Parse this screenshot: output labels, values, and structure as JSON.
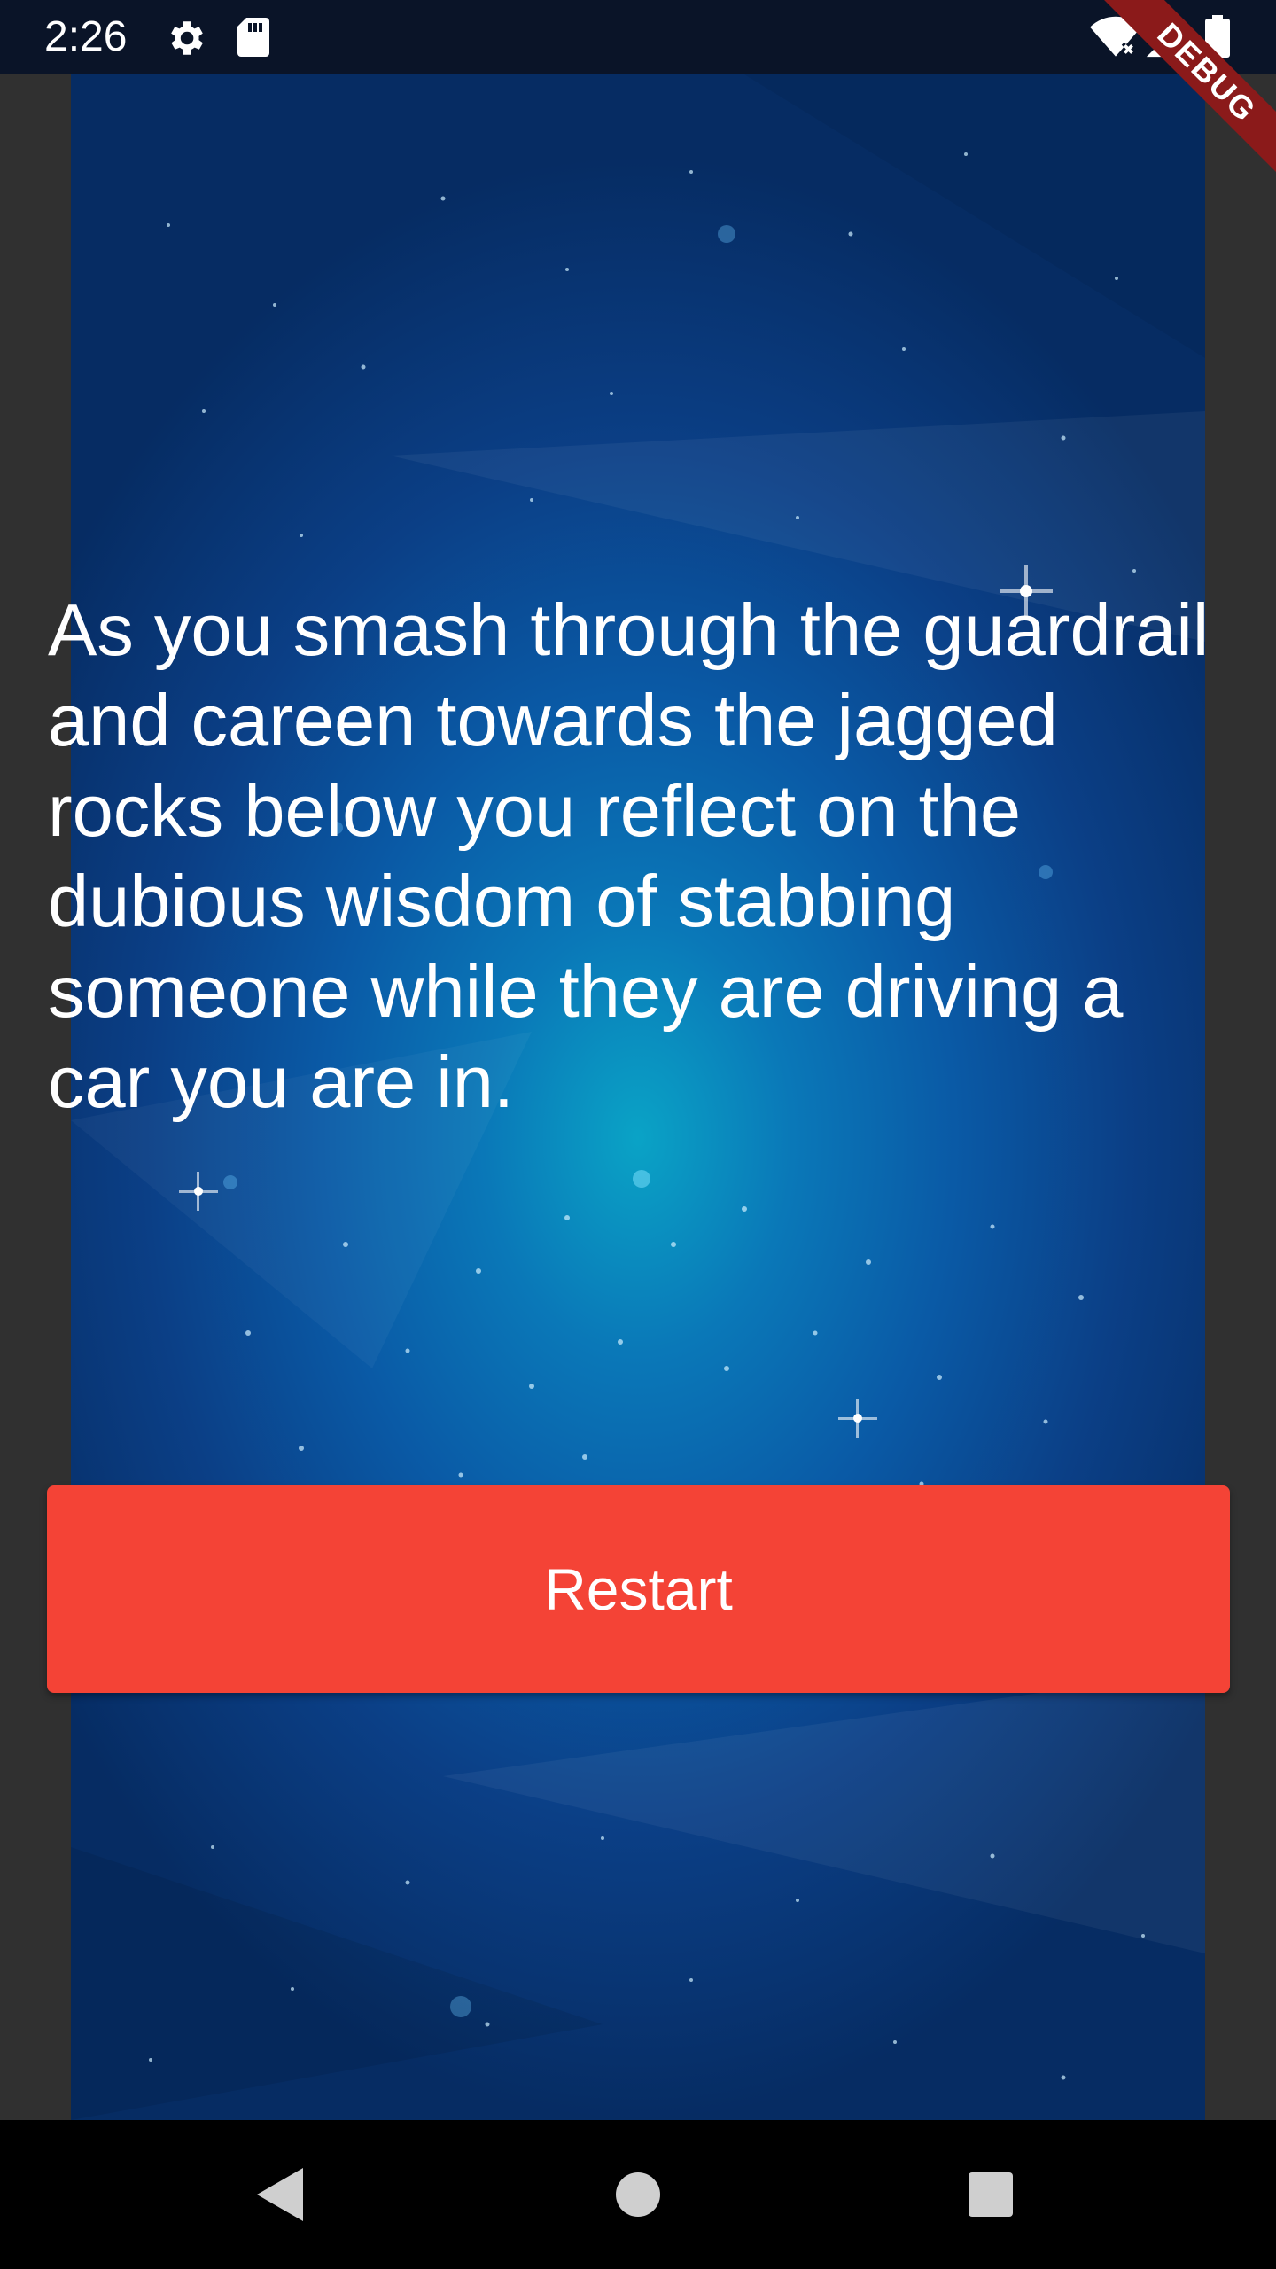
{
  "status_bar": {
    "time": "2:26",
    "icons": [
      "gear-icon",
      "sd-card-icon",
      "wifi-off-icon",
      "signal-icon",
      "battery-icon"
    ]
  },
  "debug_banner": {
    "label": "DEBUG",
    "color": "#8b1a1a"
  },
  "story": {
    "text": "As you smash through the guardrail and careen towards the jagged rocks below you reflect on the dubious wisdom of stabbing someone while they are driving a car you are in."
  },
  "restart_button": {
    "label": "Restart",
    "color": "#f44336"
  },
  "nav_bar": {
    "icons": [
      "back-triangle-icon",
      "home-circle-icon",
      "recents-square-icon"
    ]
  },
  "colors": {
    "background_deep": "#062c63",
    "background_glow": "#0aa3c6"
  }
}
